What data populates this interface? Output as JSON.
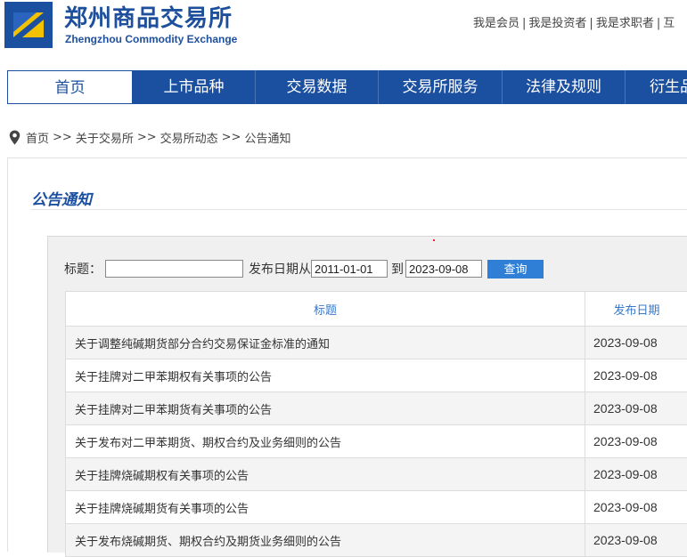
{
  "header": {
    "title": "郑州商品交易所",
    "subtitle": "Zhengzhou Commodity Exchange",
    "top_links": [
      "我是会员",
      "我是投资者",
      "我是求职者",
      "互"
    ],
    "separator": "|"
  },
  "nav": {
    "items": [
      "首页",
      "上市品种",
      "交易数据",
      "交易所服务",
      "法律及规则",
      "衍生品"
    ],
    "active_index": 0
  },
  "breadcrumb": {
    "items": [
      "首页",
      "关于交易所",
      "交易所动态",
      "公告通知"
    ],
    "separator": ">>"
  },
  "panel": {
    "title": "公告通知"
  },
  "search": {
    "title_label": "标题：",
    "title_value": "",
    "date_label": "发布日期从",
    "date_from": "2011-01-01",
    "to_label": "到",
    "date_to": "2023-09-08",
    "button_label": "查询"
  },
  "table": {
    "headers": [
      "标题",
      "发布日期"
    ],
    "rows": [
      {
        "title": "关于调整纯碱期货部分合约交易保证金标准的通知",
        "date": "2023-09-08"
      },
      {
        "title": "关于挂牌对二甲苯期权有关事项的公告",
        "date": "2023-09-08"
      },
      {
        "title": "关于挂牌对二甲苯期货有关事项的公告",
        "date": "2023-09-08"
      },
      {
        "title": "关于发布对二甲苯期货、期权合约及业务细则的公告",
        "date": "2023-09-08"
      },
      {
        "title": "关于挂牌烧碱期权有关事项的公告",
        "date": "2023-09-08"
      },
      {
        "title": "关于挂牌烧碱期货有关事项的公告",
        "date": "2023-09-08"
      },
      {
        "title": "关于发布烧碱期货、期权合约及期货业务细则的公告",
        "date": "2023-09-08"
      }
    ]
  },
  "colors": {
    "brand_blue": "#1b4fa0",
    "logo_yellow": "#f2c200",
    "button_blue": "#2f7fd6",
    "header_text_blue": "#3a78c8"
  }
}
